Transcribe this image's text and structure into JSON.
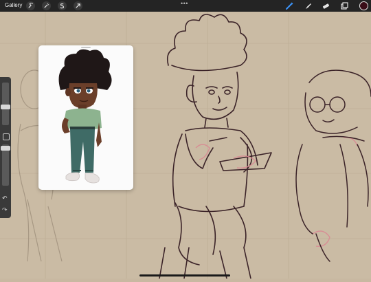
{
  "app": {
    "gallery_label": "Gallery",
    "more_dots": "•••",
    "current_color": "#3a0d18"
  },
  "toolbar_left": [
    {
      "name": "actions-wrench-icon"
    },
    {
      "name": "adjustments-wand-icon"
    },
    {
      "name": "selection-s-icon"
    },
    {
      "name": "transform-arrow-icon"
    }
  ],
  "toolbar_right": [
    {
      "name": "brush-icon"
    },
    {
      "name": "smudge-icon"
    },
    {
      "name": "eraser-icon"
    },
    {
      "name": "layers-icon"
    }
  ],
  "sidebar": {
    "undo_glyph": "↶",
    "redo_glyph": "↷"
  },
  "reference": {
    "title": ""
  }
}
